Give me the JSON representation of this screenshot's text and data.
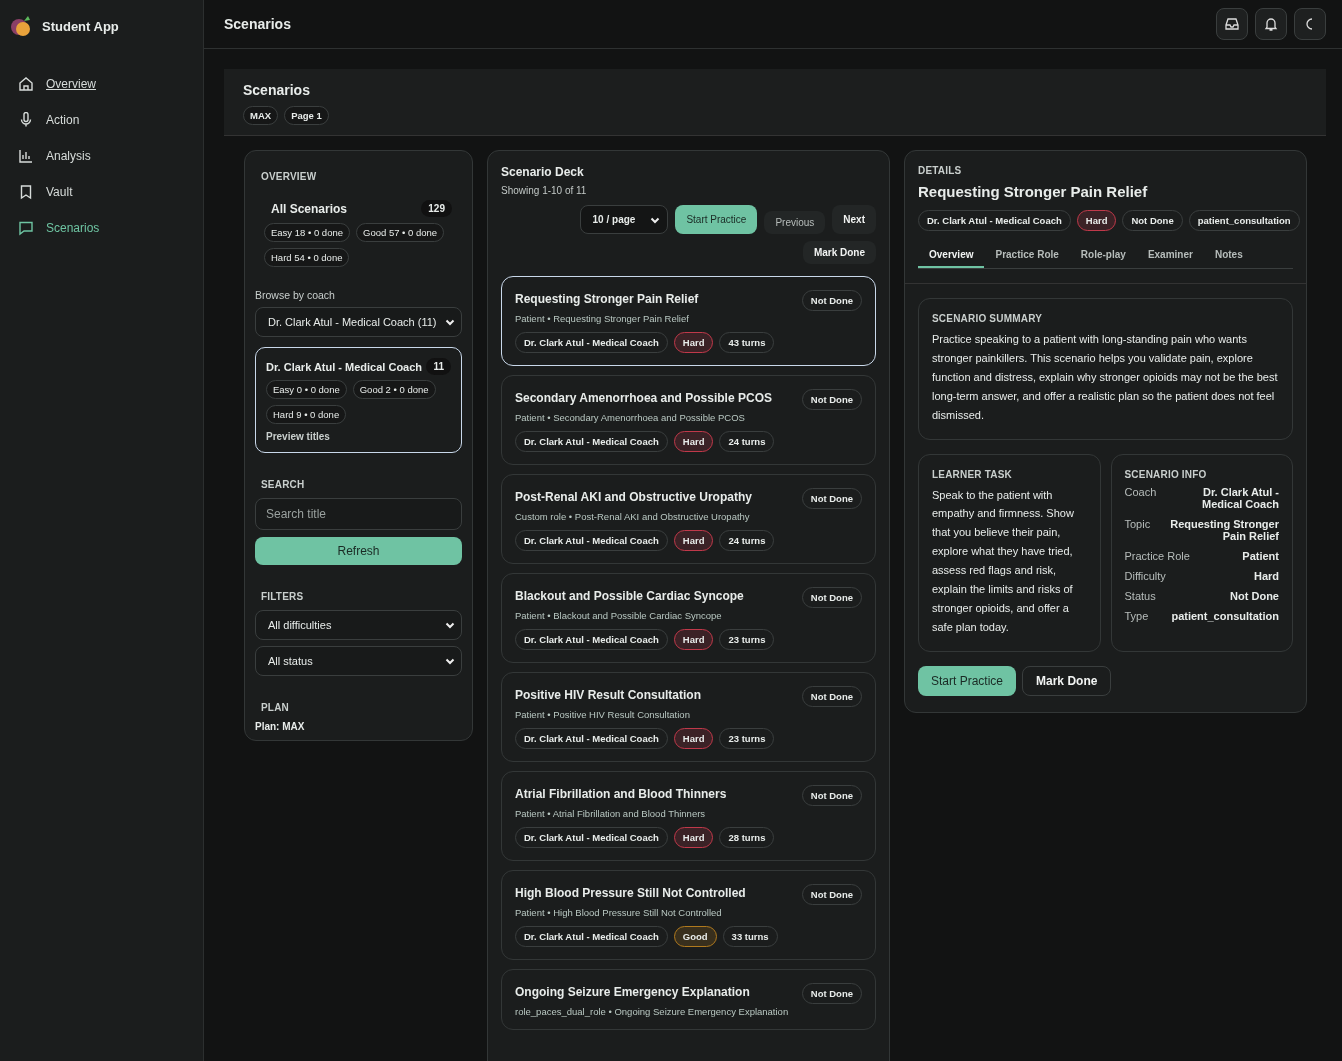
{
  "app": {
    "name": "Student App"
  },
  "nav": [
    {
      "label": "Overview",
      "kind": "home",
      "selected": false,
      "underlined": true
    },
    {
      "label": "Action",
      "kind": "mic",
      "selected": false,
      "underlined": false
    },
    {
      "label": "Analysis",
      "kind": "chart",
      "selected": false,
      "underlined": false
    },
    {
      "label": "Vault",
      "kind": "bookmark",
      "selected": false,
      "underlined": false
    },
    {
      "label": "Scenarios",
      "kind": "chat",
      "selected": true,
      "underlined": false
    }
  ],
  "topbar": {
    "title": "Scenarios"
  },
  "page_header": {
    "title": "Scenarios",
    "chips": [
      "MAX",
      "Page 1"
    ]
  },
  "overview": {
    "heading": "OVERVIEW",
    "all_label": "All Scenarios",
    "all_count": "129",
    "all_chips": [
      "Easy 18 • 0 done",
      "Good 57 • 0 done",
      "Hard 54 • 0 done"
    ],
    "browse_label": "Browse by coach",
    "coach_select": "Dr. Clark Atul - Medical Coach (11)",
    "coach_card": {
      "name": "Dr. Clark Atul - Medical Coach",
      "count": "11",
      "chips": [
        "Easy 0 • 0 done",
        "Good 2 • 0 done",
        "Hard 9 • 0 done"
      ],
      "link": "Preview titles",
      "selected": true
    },
    "search_heading": "SEARCH",
    "search": {
      "placeholder": "Search title"
    },
    "refresh": "Refresh",
    "filters_heading": "FILTERS",
    "filters": [
      "All difficulties",
      "All status"
    ],
    "plan_heading": "PLAN",
    "plan": "Plan: MAX"
  },
  "deck": {
    "title": "Scenario Deck",
    "showing": "Showing 1-10 of 11",
    "page_size": "10 / page",
    "buttons": [
      {
        "label": "Start Practice",
        "kind": "primary"
      },
      {
        "label": "Previous",
        "kind": "muted"
      },
      {
        "label": "Next",
        "kind": "plain"
      },
      {
        "label": "Mark Done",
        "kind": "plain"
      }
    ],
    "cards": [
      {
        "title": "Requesting Stronger Pain Relief",
        "subtitle": "Patient • Requesting Stronger Pain Relief",
        "status": "Not Done",
        "coach": "Dr. Clark Atul - Medical Coach",
        "difficulty": {
          "label": "Hard",
          "color": "#c0394a"
        },
        "turns": "43 turns",
        "selected": true
      },
      {
        "title": "Secondary Amenorrhoea and Possible PCOS",
        "subtitle": "Patient • Secondary Amenorrhoea and Possible PCOS",
        "status": "Not Done",
        "coach": "Dr. Clark Atul - Medical Coach",
        "difficulty": {
          "label": "Hard",
          "color": "#c0394a"
        },
        "turns": "24 turns",
        "selected": false
      },
      {
        "title": "Post-Renal AKI and Obstructive Uropathy",
        "subtitle": "Custom role • Post-Renal AKI and Obstructive Uropathy",
        "status": "Not Done",
        "coach": "Dr. Clark Atul - Medical Coach",
        "difficulty": {
          "label": "Hard",
          "color": "#c0394a"
        },
        "turns": "24 turns",
        "selected": false
      },
      {
        "title": "Blackout and Possible Cardiac Syncope",
        "subtitle": "Patient • Blackout and Possible Cardiac Syncope",
        "status": "Not Done",
        "coach": "Dr. Clark Atul - Medical Coach",
        "difficulty": {
          "label": "Hard",
          "color": "#c0394a"
        },
        "turns": "23 turns",
        "selected": false
      },
      {
        "title": "Positive HIV Result Consultation",
        "subtitle": "Patient • Positive HIV Result Consultation",
        "status": "Not Done",
        "coach": "Dr. Clark Atul - Medical Coach",
        "difficulty": {
          "label": "Hard",
          "color": "#c0394a"
        },
        "turns": "23 turns",
        "selected": false
      },
      {
        "title": "Atrial Fibrillation and Blood Thinners",
        "subtitle": "Patient • Atrial Fibrillation and Blood Thinners",
        "status": "Not Done",
        "coach": "Dr. Clark Atul - Medical Coach",
        "difficulty": {
          "label": "Hard",
          "color": "#c0394a"
        },
        "turns": "28 turns",
        "selected": false
      },
      {
        "title": "High Blood Pressure Still Not Controlled",
        "subtitle": "Patient • High Blood Pressure Still Not Controlled",
        "status": "Not Done",
        "coach": "Dr. Clark Atul - Medical Coach",
        "difficulty": {
          "label": "Good",
          "color": "#b07a1e"
        },
        "turns": "33 turns",
        "selected": false
      },
      {
        "title": "Ongoing Seizure Emergency Explanation",
        "subtitle": "role_paces_dual_role • Ongoing Seizure Emergency Explanation",
        "status": "Not Done",
        "selected": false
      }
    ]
  },
  "details": {
    "heading": "DETAILS",
    "title": "Requesting Stronger Pain Relief",
    "tags": [
      {
        "label": "Dr. Clark Atul - Medical Coach"
      },
      {
        "label": "Hard",
        "color": "#c0394a"
      },
      {
        "label": "Not Done"
      },
      {
        "label": "patient_consultation"
      }
    ],
    "tabs": [
      {
        "label": "Overview",
        "selected": true
      },
      {
        "label": "Practice Role",
        "selected": false
      },
      {
        "label": "Role-play",
        "selected": false
      },
      {
        "label": "Examiner",
        "selected": false
      },
      {
        "label": "Notes",
        "selected": false
      }
    ],
    "summary": {
      "heading": "SCENARIO SUMMARY",
      "text": "Practice speaking to a patient with long-standing pain who wants stronger painkillers. This scenario helps you validate pain, explore function and distress, explain why stronger opioids may not be the best long-term answer, and offer a realistic plan so the patient does not feel dismissed."
    },
    "task": {
      "heading": "LEARNER TASK",
      "text": "Speak to the patient with empathy and firmness. Show that you believe their pain, explore what they have tried, assess red flags and risk, explain the limits and risks of stronger opioids, and offer a safe plan today."
    },
    "info": {
      "heading": "SCENARIO INFO",
      "rows": [
        {
          "label": "Coach",
          "value": "Dr. Clark Atul - Medical Coach"
        },
        {
          "label": "Topic",
          "value": "Requesting Stronger Pain Relief"
        },
        {
          "label": "Practice Role",
          "value": "Patient"
        },
        {
          "label": "Difficulty",
          "value": "Hard"
        },
        {
          "label": "Status",
          "value": "Not Done"
        },
        {
          "label": "Type",
          "value": "patient_consultation"
        }
      ]
    },
    "actions": [
      {
        "label": "Start Practice",
        "kind": "primary"
      },
      {
        "label": "Mark Done",
        "kind": "plain"
      }
    ]
  }
}
